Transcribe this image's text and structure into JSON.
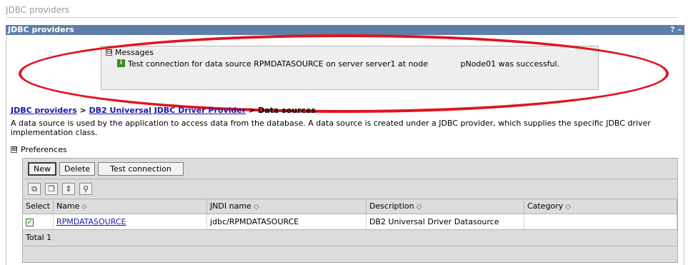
{
  "page_caption": "JDBC providers",
  "portlet": {
    "title": "JDBC providers",
    "help_label": "?",
    "minimize_label": "–"
  },
  "messages": {
    "toggle": "⊟",
    "header": "Messages",
    "info_icon": "i",
    "text": "Test connection for data source RPMDATASOURCE on server server1 at node             pNode01 was successful."
  },
  "breadcrumb": {
    "items": [
      "JDBC providers",
      "DB2 Universal JDBC Driver Provider"
    ],
    "separator": ">",
    "current": "Data sources"
  },
  "intro_text": "A data source is used by the application to access data from the database. A data source is created under a JDBC provider, which supplies the specific JDBC driver implementation class.",
  "preferences": {
    "toggle": "⊞",
    "label": "Preferences"
  },
  "toolbar": {
    "new_label": "New",
    "delete_label": "Delete",
    "test_label": "Test connection"
  },
  "icon_bar": [
    {
      "name": "select-all-icon",
      "glyph": "⧉"
    },
    {
      "name": "deselect-all-icon",
      "glyph": "❐"
    },
    {
      "name": "show-filter-icon",
      "glyph": "⇕"
    },
    {
      "name": "clear-filter-icon",
      "glyph": "⚲"
    }
  ],
  "table": {
    "columns": [
      "Select",
      "Name",
      "JNDI name",
      "Description",
      "Category"
    ],
    "sort_glyph": "◇",
    "sort_active_glyph": "⬦",
    "rows": [
      {
        "selected": true,
        "check_glyph": "✓",
        "name": "RPMDATASOURCE",
        "jndi": "jdbc/RPMDATASOURCE",
        "description": "DB2 Universal Driver Datasource",
        "category": ""
      }
    ],
    "total_label": "Total 1"
  },
  "colors": {
    "title_bar": "#5d7fa8",
    "link": "#1a1aa6",
    "annotation_ellipse": "#e0141e",
    "message_bg": "#eeeeee"
  }
}
